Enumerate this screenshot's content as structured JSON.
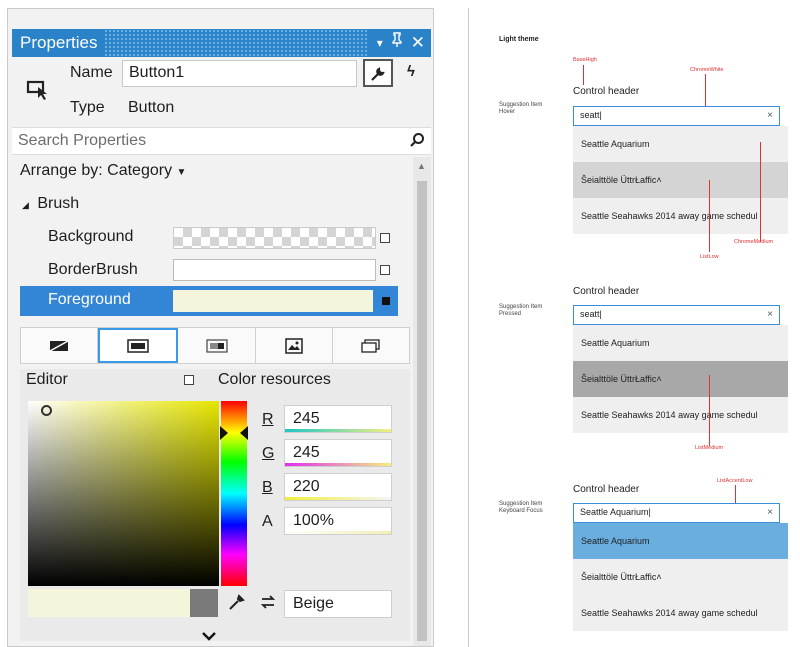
{
  "properties": {
    "title": "Properties",
    "title_icons": {
      "dropdown": "▾",
      "pin": "ᵖ",
      "close": "✕"
    },
    "name_label": "Name",
    "name_value": "Button1",
    "type_label": "Type",
    "type_value": "Button",
    "search_placeholder": "Search Properties",
    "arrange_label": "Arrange by: Category",
    "group": "Brush",
    "rows": [
      {
        "label": "Background"
      },
      {
        "label": "BorderBrush"
      },
      {
        "label": "Foreground"
      }
    ],
    "editor_label": "Editor",
    "color_resources_label": "Color resources",
    "r_label": "R",
    "r_value": "245",
    "g_label": "G",
    "g_value": "245",
    "b_label": "B",
    "b_value": "220",
    "a_label": "A",
    "a_value": "100%",
    "color_name": "Beige",
    "selected_color": "#f5f5dc"
  },
  "spec": {
    "heading": "Light theme",
    "sections": [
      {
        "side_label": "Suggestion Item\nHover",
        "header": "Control header",
        "query": "seatt|",
        "items": [
          "Seattle Aquarium",
          "Šeialttöle ÜttrŁaffic˄",
          "Seattle Seahawks 2014 away game schedul"
        ]
      },
      {
        "side_label": "Suggestion Item\nPressed",
        "header": "Control header",
        "query": "seatt|",
        "items": [
          "Seattle Aquarium",
          "Šeialttöle ÜttrŁaffic˄",
          "Seattle Seahawks 2014 away game schedul"
        ]
      },
      {
        "side_label": "Suggestion Item\nKeyboard Focus",
        "header": "Control header",
        "query": "Seattle Aquarium|",
        "items": [
          "Seattle Aquarium",
          "Šeialttöle ÜttrŁaffic˄",
          "Seattle Seahawks 2014 away game schedul"
        ]
      }
    ],
    "annotations": {
      "basehigh": "BaseHigh",
      "chromewhite": "ChromeWhite",
      "chromemedium": "ChromeMedium",
      "listlow": "ListLow",
      "listmedium": "ListMedium",
      "listaccentlow": "ListAccentLow"
    },
    "colors": {
      "accent": "#2a83c9",
      "highlight": "#6aaee0",
      "pressed": "#a9a9a9",
      "hover": "#d5d5d5",
      "annot": "#e53030"
    }
  }
}
